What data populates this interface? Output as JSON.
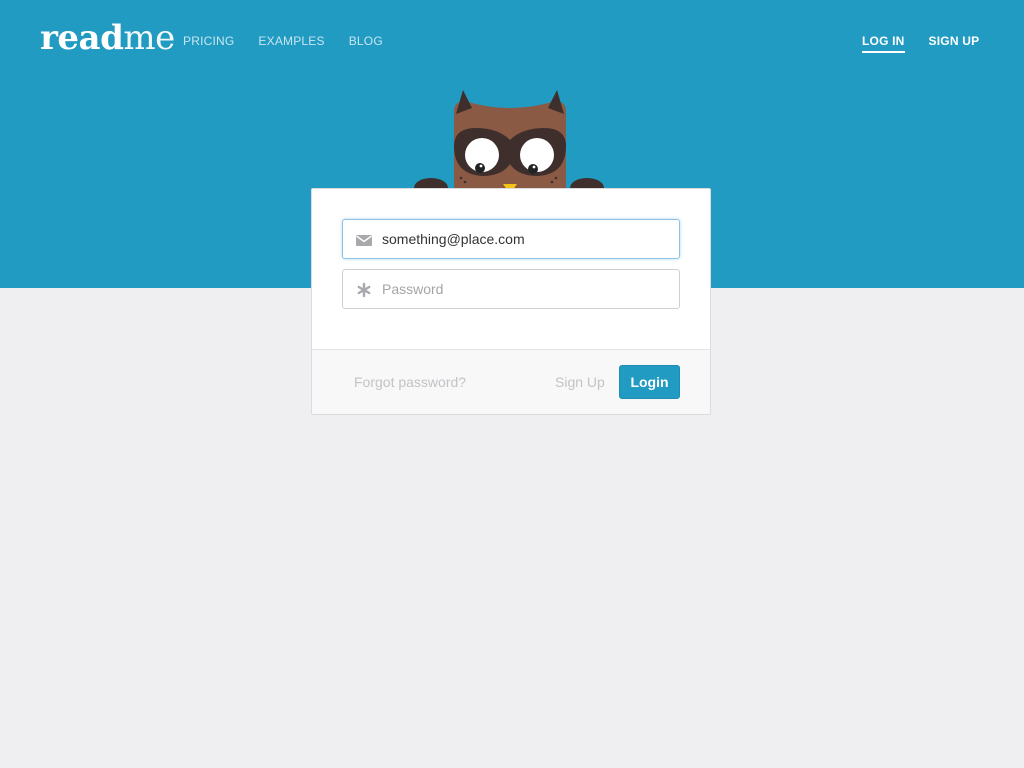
{
  "header": {
    "logo_bold": "read",
    "logo_light": "me",
    "nav_left": [
      {
        "label": "PRICING"
      },
      {
        "label": "EXAMPLES"
      },
      {
        "label": "BLOG"
      }
    ],
    "nav_right": [
      {
        "label": "LOG IN",
        "active": true
      },
      {
        "label": "SIGN UP"
      }
    ]
  },
  "login_form": {
    "email": {
      "value": "something@place.com",
      "icon": "envelope-icon"
    },
    "password": {
      "placeholder": "Password",
      "icon": "asterisk-icon"
    },
    "forgot_label": "Forgot password?",
    "signup_label": "Sign Up",
    "login_label": "Login"
  },
  "mascot": "owl",
  "colors": {
    "brand": "#219bc2",
    "background": "#efeff1",
    "owl_brown": "#8b5a44",
    "owl_dark": "#3e2f2c",
    "beak": "#f3c316"
  }
}
